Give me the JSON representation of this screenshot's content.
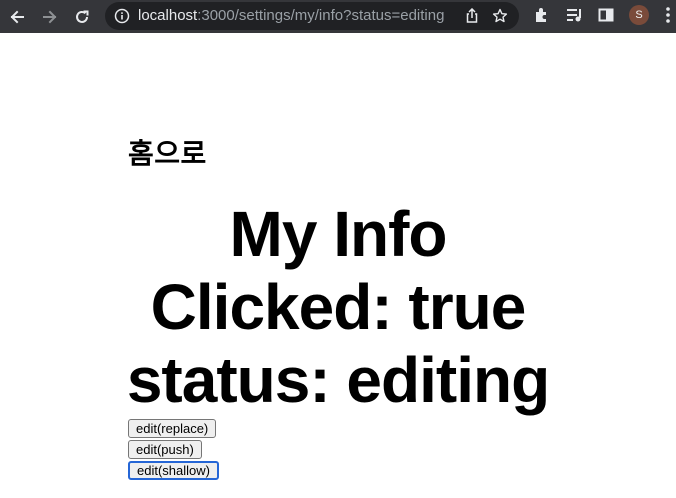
{
  "browser": {
    "url_host": "localhost",
    "url_rest": ":3000/settings/my/info?status=editing",
    "profile_initial": "S"
  },
  "page": {
    "home_link": "홈으로",
    "title": "My Info",
    "clicked_line": "Clicked: true",
    "status_line": "status: editing",
    "buttons": [
      {
        "label": "edit(replace)"
      },
      {
        "label": "edit(push)"
      },
      {
        "label": "edit(shallow)"
      }
    ]
  },
  "colors": {
    "toolbar_bg": "#35363a",
    "omnibox_bg": "#202124",
    "focus_ring": "#2566d6"
  }
}
